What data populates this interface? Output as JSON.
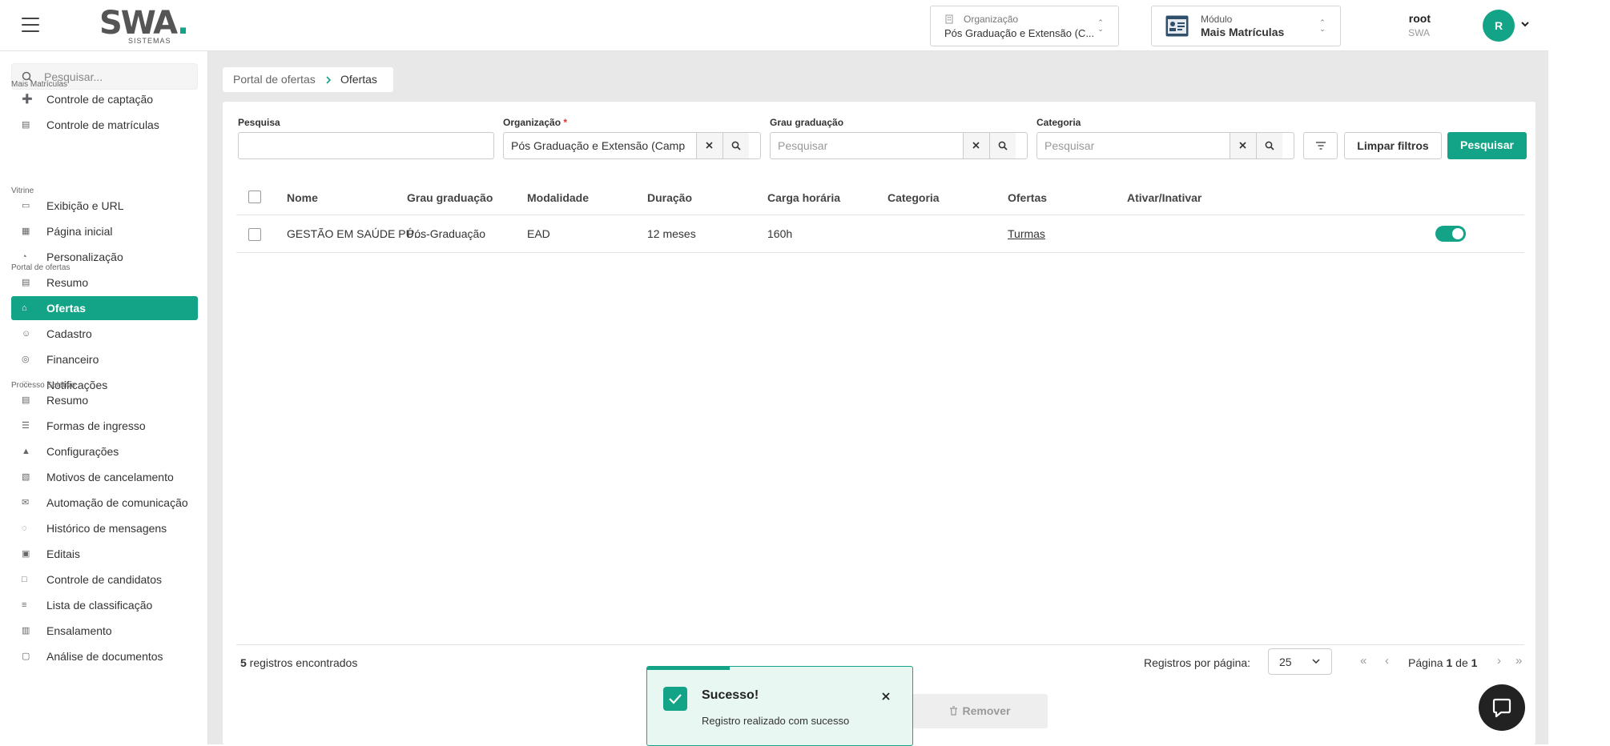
{
  "header": {
    "logo_text": "SWA",
    "logo_sub": "SISTEMAS",
    "organization_label": "Organização",
    "organization_value": "Pós Graduação e Extensão (C...",
    "module_label": "Módulo",
    "module_value": "Mais Matrículas",
    "user_name": "root",
    "user_org": "SWA",
    "avatar_initial": "R"
  },
  "sidebar": {
    "search_placeholder": "Pesquisar...",
    "sections": [
      {
        "title": "Mais Matrículas",
        "items": [
          {
            "label": "Controle de captação",
            "icon": "user-plus-icon"
          },
          {
            "label": "Controle de matrículas",
            "icon": "id-card-icon"
          }
        ]
      },
      {
        "title": "Vitrine",
        "items": [
          {
            "label": "Exibição e URL",
            "icon": "browser-icon"
          },
          {
            "label": "Página inicial",
            "icon": "grid-icon"
          },
          {
            "label": "Personalização",
            "icon": "palette-icon"
          }
        ]
      },
      {
        "title": "Portal de ofertas",
        "items": [
          {
            "label": "Resumo",
            "icon": "summary-icon"
          },
          {
            "label": "Ofertas",
            "icon": "cart-icon",
            "active": true
          },
          {
            "label": "Cadastro",
            "icon": "user-edit-icon"
          },
          {
            "label": "Financeiro",
            "icon": "coin-icon"
          },
          {
            "label": "Notificações",
            "icon": "bell-icon"
          }
        ]
      },
      {
        "title": "Processo Seletivo",
        "items": [
          {
            "label": "Resumo",
            "icon": "summary-icon"
          },
          {
            "label": "Formas de ingresso",
            "icon": "list-icon"
          },
          {
            "label": "Configurações",
            "icon": "graduation-cap-icon"
          },
          {
            "label": "Motivos de cancelamento",
            "icon": "document-x-icon"
          },
          {
            "label": "Automação de comunicação",
            "icon": "mail-icon"
          },
          {
            "label": "Histórico de mensagens",
            "icon": "chat-icon"
          },
          {
            "label": "Editais",
            "icon": "calendar-icon"
          },
          {
            "label": "Controle de candidatos",
            "icon": "document-icon"
          },
          {
            "label": "Lista de classificação",
            "icon": "ranking-icon"
          },
          {
            "label": "Ensalamento",
            "icon": "building-icon"
          },
          {
            "label": "Análise de documentos",
            "icon": "file-check-icon"
          }
        ]
      }
    ]
  },
  "breadcrumb": {
    "parent": "Portal de ofertas",
    "current": "Ofertas"
  },
  "filters": {
    "search_label": "Pesquisa",
    "search_value": "",
    "org_label": "Organização",
    "org_required": "*",
    "org_value": "Pós Graduação e Extensão (Camp",
    "grau_label": "Grau graduação",
    "grau_placeholder": "Pesquisar",
    "categoria_label": "Categoria",
    "categoria_placeholder": "Pesquisar",
    "clear_label": "Limpar filtros",
    "search_button": "Pesquisar"
  },
  "table": {
    "columns": [
      "Nome",
      "Grau graduação",
      "Modalidade",
      "Duração",
      "Carga horária",
      "Categoria",
      "Ofertas",
      "Ativar/Inativar"
    ],
    "rows": [
      {
        "nome": "GESTÃO EM SAÚDE PÚ...",
        "grau": "Pós-Graduação",
        "modalidade": "EAD",
        "duracao": "12 meses",
        "carga": "160h",
        "categoria": "",
        "ofertas": "Turmas",
        "ativo": true
      }
    ]
  },
  "footer": {
    "count": "5",
    "count_suffix": " registros encontrados",
    "per_page_label": "Registros por página:",
    "per_page_value": "25",
    "page_prefix": "Página ",
    "page_current": "1",
    "page_of": " de ",
    "page_total": "1",
    "remove_label": "Remover"
  },
  "toast": {
    "title": "Sucesso!",
    "message": "Registro realizado com sucesso",
    "progress": 0.31
  },
  "colors": {
    "accent": "#13a386",
    "background": "#e8e8e8"
  }
}
